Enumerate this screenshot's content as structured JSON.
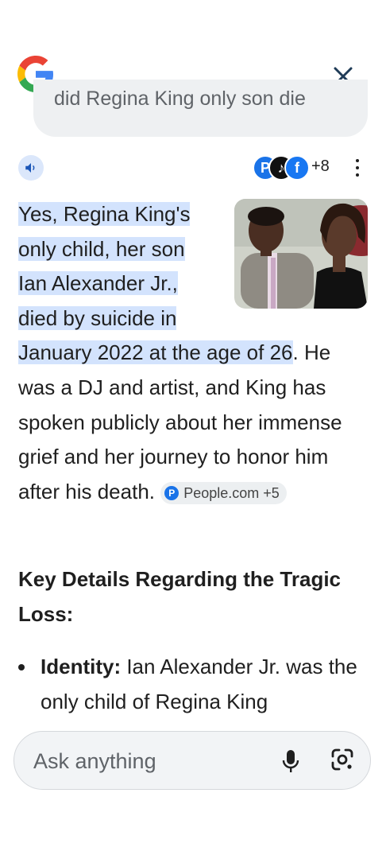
{
  "header": {
    "logo_icon": "google-g-logo",
    "close_icon": "close-icon",
    "query_partial": "did Regina King only son die"
  },
  "toolbar": {
    "speaker_icon": "volume-icon",
    "sources": [
      {
        "letter": "P",
        "color": "#1a73e8"
      },
      {
        "letter": "♪",
        "color": "#111111"
      },
      {
        "letter": "f",
        "color": "#1877f2"
      }
    ],
    "sources_more": "+8",
    "more_icon": "more-vert-icon"
  },
  "answer": {
    "highlight_lines": [
      "Yes, Regina King's",
      "only child, her son",
      "Ian Alexander Jr.,",
      "died by suicide in",
      "January 2022 at the age of 26"
    ],
    "rest_text": ". He was a DJ and artist, and King has spoken publicly about her immense grief and her journey to honor him after his death.",
    "citation": {
      "label": "People.com +5",
      "icon": "P"
    }
  },
  "section": {
    "heading": "Key Details Regarding the Tragic Loss:",
    "bullets": [
      {
        "label": "Identity:",
        "text": " Ian Alexander Jr. was the only child of Regina King"
      }
    ]
  },
  "composer": {
    "placeholder": "Ask anything",
    "mic_icon": "mic-icon",
    "lens_icon": "google-lens-icon"
  },
  "colors": {
    "highlight": "#d3e3fd",
    "pill_bg": "#eef0f2",
    "accent": "#1a73e8"
  }
}
